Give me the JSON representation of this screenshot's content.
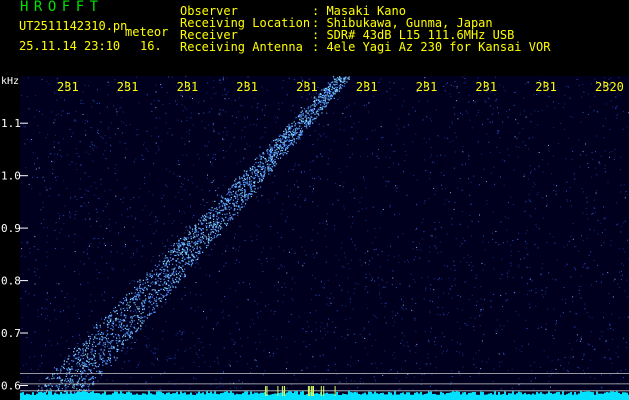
{
  "header": {
    "app_name": "HROFFT",
    "file_name": "UT2511142310.pn",
    "meteor_label": "meteor",
    "timestamp": "25.11.14 23:10",
    "counter": "16.",
    "fields": [
      {
        "label": "Observer",
        "value": ": Masaki Kano"
      },
      {
        "label": "Receiving Location",
        "value": ": Shibukawa, Gunma, Japan"
      },
      {
        "label": "Receiver",
        "value": ": SDR# 43dB L15 111.6MHz USB"
      },
      {
        "label": "Receiving Antenna",
        "value": ": 4ele Yagi Az 230 for Kansai VOR"
      }
    ]
  },
  "chart_data": {
    "type": "heatmap",
    "y_unit": "kHz",
    "x_tick_labels": [
      "231",
      "231",
      "231",
      "231",
      "231",
      "231",
      "231",
      "231",
      "231",
      "2320"
    ],
    "y_tick_labels": [
      "1.1",
      "1.0",
      "0.9",
      "0.8",
      "0.7",
      "0.6"
    ],
    "y_ticks": [
      1.1,
      1.0,
      0.9,
      0.8,
      0.7,
      0.6
    ],
    "ylim": [
      0.58,
      1.19
    ],
    "x_minutes": [
      23.11,
      23.12,
      23.13,
      23.14,
      23.15,
      23.16,
      23.17,
      23.18,
      23.19,
      23.2
    ],
    "reference_lines_khz": [
      0.623,
      0.603,
      0.59
    ],
    "meteor_trace": {
      "start_x": 0.06,
      "end_x": 0.53,
      "start_khz": 0.58,
      "end_khz": 1.19
    },
    "colors": {
      "background": "#00001e",
      "noise": "#2a56d8",
      "trace": "#80d8ff",
      "tick": "#ffff00",
      "axis_label": "#ffffff",
      "ref_line": "#c8c8c8",
      "baseline": "#00e0ff"
    }
  }
}
